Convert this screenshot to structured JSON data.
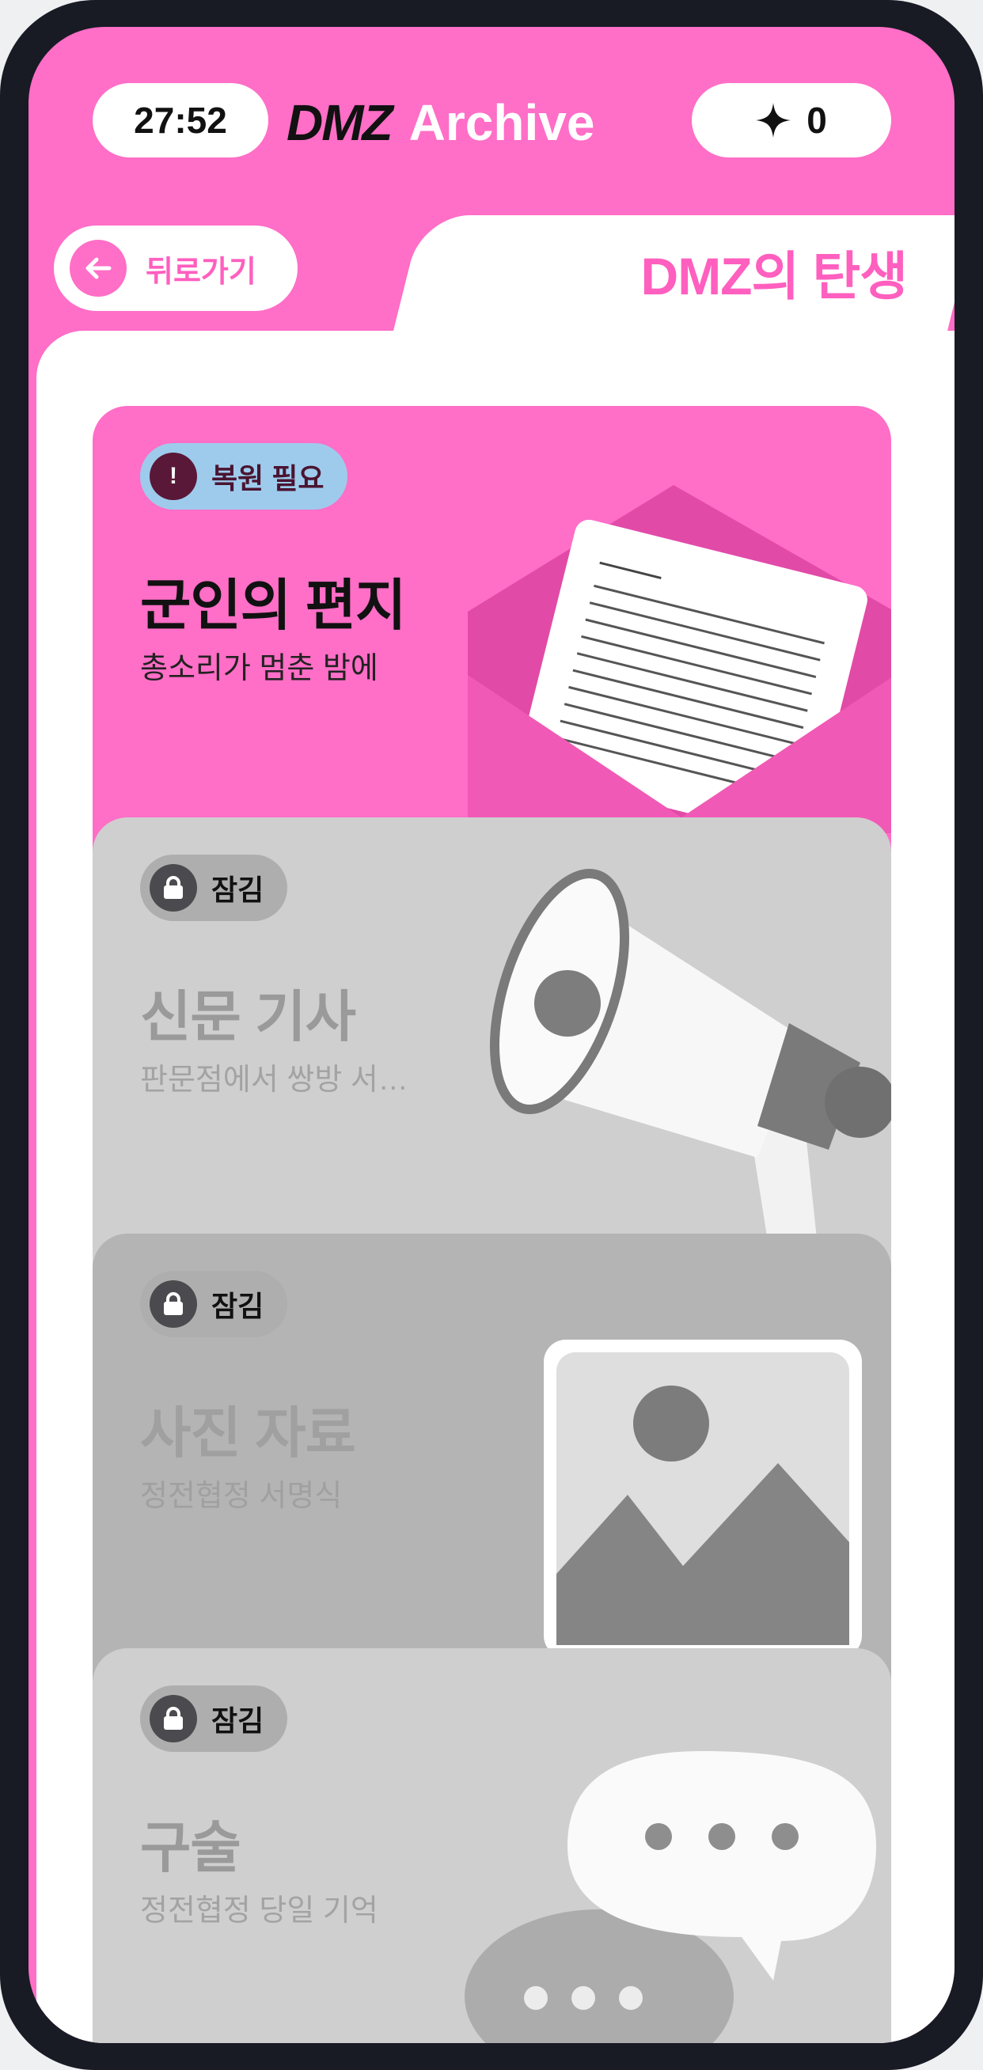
{
  "header": {
    "timer": "27:52",
    "logo_dmz": "DMZ",
    "logo_archive": "Archive",
    "points": "0"
  },
  "nav": {
    "back_label": "뒤로가기",
    "page_title": "DMZ의 탄생"
  },
  "cards": [
    {
      "badge": "복원 필요",
      "badge_icon": "exclamation",
      "title": "군인의 편지",
      "subtitle": "총소리가 멈춘 밤에",
      "status": "needs-restore",
      "illustration": "envelope-letter"
    },
    {
      "badge": "잠김",
      "badge_icon": "lock",
      "title": "신문 기사",
      "subtitle": "판문점에서 쌍방 서…",
      "status": "locked",
      "illustration": "megaphone"
    },
    {
      "badge": "잠김",
      "badge_icon": "lock",
      "title": "사진 자료",
      "subtitle": "정전협정 서명식",
      "status": "locked",
      "illustration": "photo-frame"
    },
    {
      "badge": "잠김",
      "badge_icon": "lock",
      "title": "구술",
      "subtitle": "정전협정 당일 기억",
      "status": "locked",
      "illustration": "speech-bubbles"
    }
  ],
  "colors": {
    "brand_pink": "#ff6ec7",
    "restore_badge": "#9ecbec",
    "locked_card": "#cfcfcf"
  }
}
